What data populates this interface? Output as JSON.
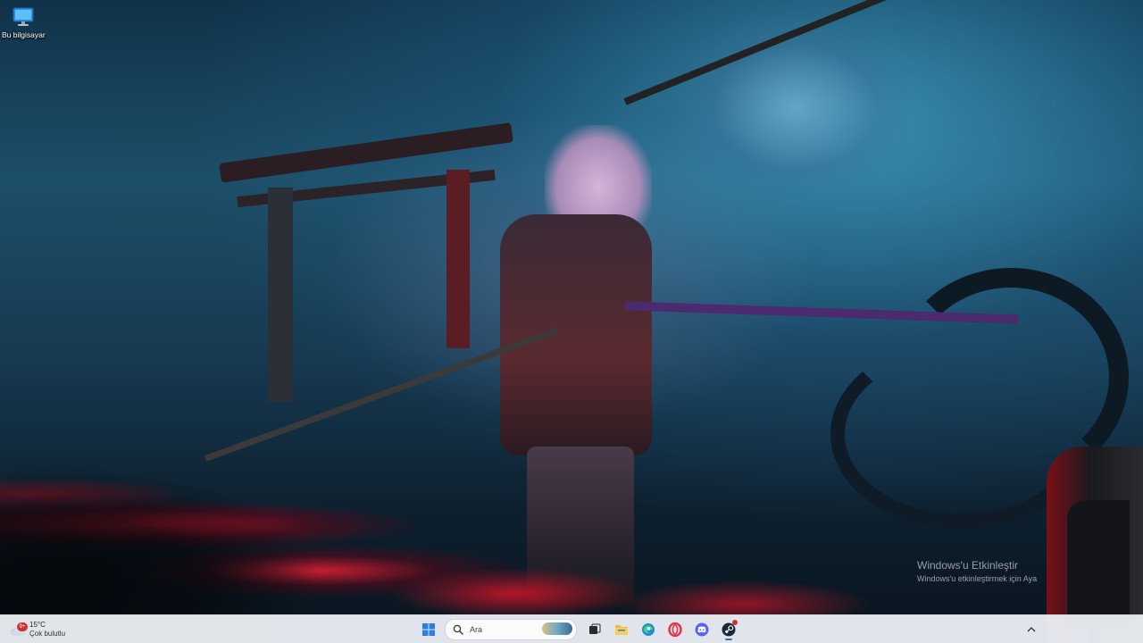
{
  "desktop": {
    "icons": [
      {
        "label": "Bu bilgisayar",
        "icon": "monitor-icon"
      }
    ]
  },
  "watermark": {
    "title": "Windows'u Etkinleştir",
    "subtitle": "Windows'u etkinleştirmek için Aya"
  },
  "taskbar": {
    "weather": {
      "badge": "9+",
      "temperature": "15°C",
      "condition": "Çok bulutlu",
      "icon": "cloud-icon"
    },
    "start_icon": "windows-start-icon",
    "search": {
      "placeholder": "Ara",
      "icon": "search-icon"
    },
    "apps": [
      {
        "name": "task-view",
        "icon": "task-view-icon"
      },
      {
        "name": "file-explorer",
        "icon": "folder-icon"
      },
      {
        "name": "edge",
        "icon": "edge-icon"
      },
      {
        "name": "opera",
        "icon": "opera-icon"
      },
      {
        "name": "discord",
        "icon": "discord-icon"
      },
      {
        "name": "steam",
        "icon": "steam-icon",
        "active": true
      }
    ],
    "tray_chevron": "^",
    "colors": {
      "taskbar_bg": "#e8ecf2",
      "accent": "#2b6fd1",
      "badge": "#d0312d"
    }
  }
}
